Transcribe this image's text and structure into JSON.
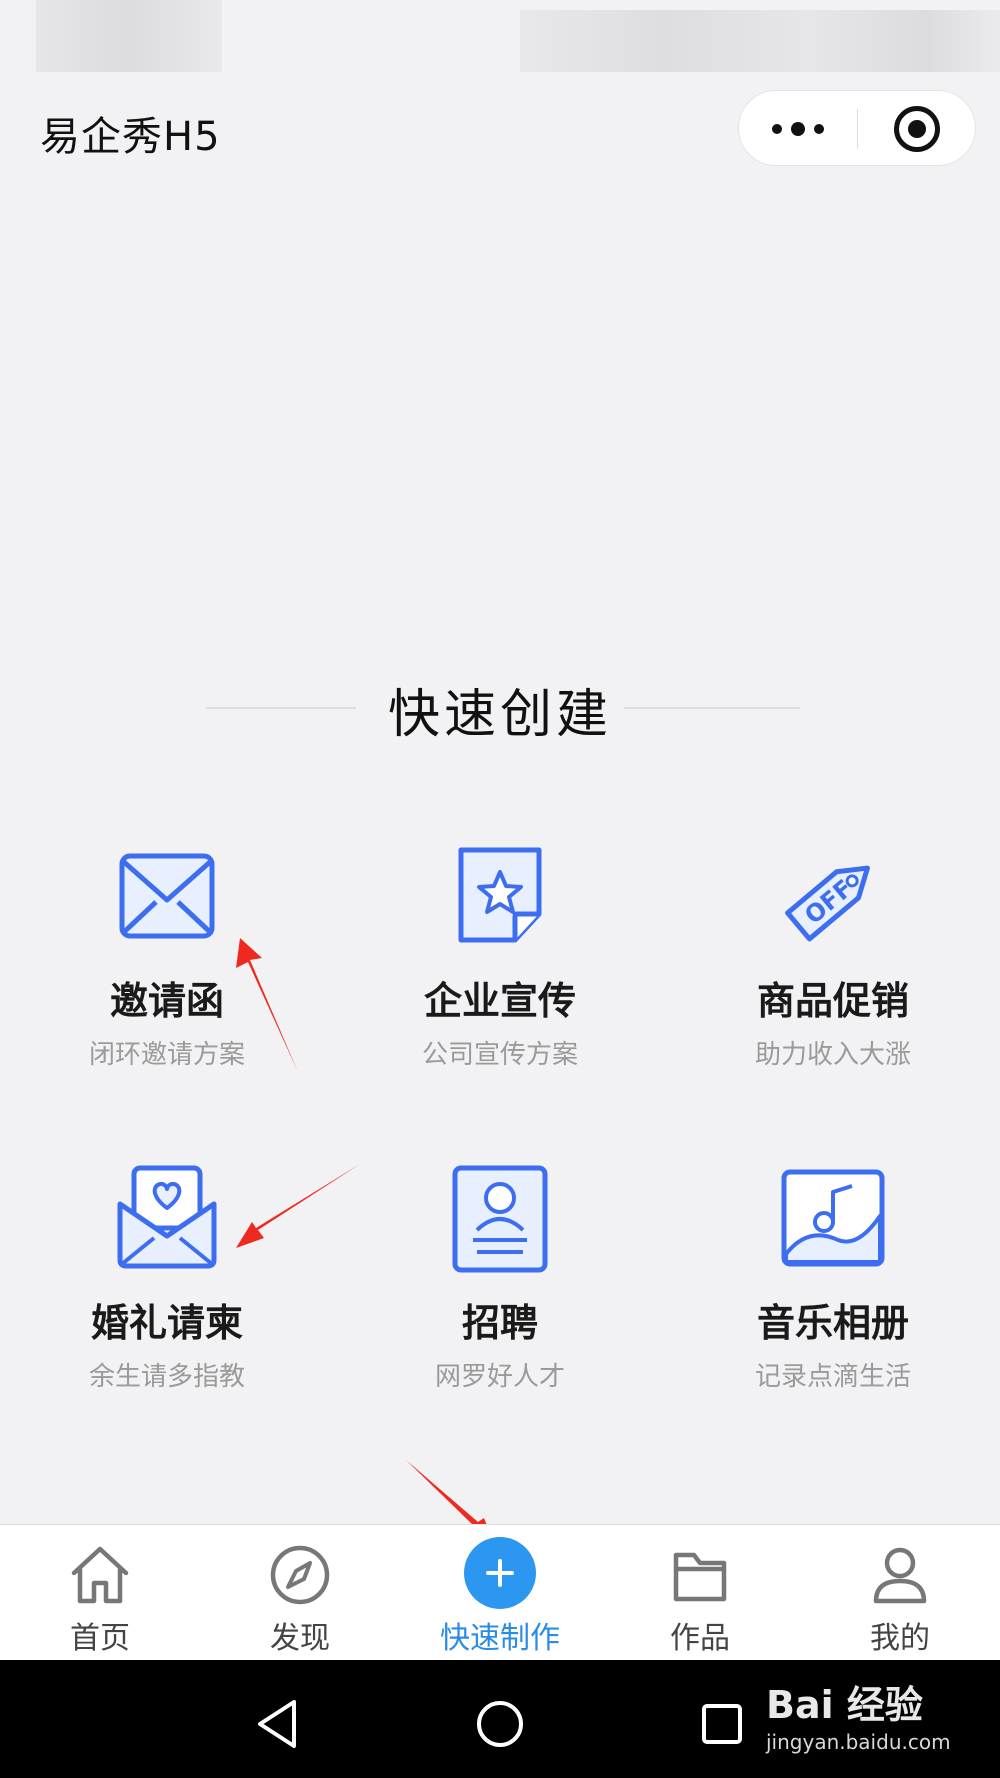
{
  "app": {
    "title": "易企秀H5"
  },
  "section": {
    "title": "快速创建"
  },
  "templates": [
    {
      "label": "邀请函",
      "desc": "闭环邀请方案",
      "icon": "envelope-icon"
    },
    {
      "label": "企业宣传",
      "desc": "公司宣传方案",
      "icon": "star-document-icon"
    },
    {
      "label": "商品促销",
      "desc": "助力收入大涨",
      "icon": "off-tag-icon"
    },
    {
      "label": "婚礼请柬",
      "desc": "余生请多指教",
      "icon": "heart-envelope-icon"
    },
    {
      "label": "招聘",
      "desc": "网罗好人才",
      "icon": "resume-icon"
    },
    {
      "label": "音乐相册",
      "desc": "记录点滴生活",
      "icon": "music-photo-icon"
    }
  ],
  "tabbar": [
    {
      "label": "首页",
      "icon": "home-icon"
    },
    {
      "label": "发现",
      "icon": "compass-icon"
    },
    {
      "label": "快速制作",
      "icon": "plus-icon",
      "active": true
    },
    {
      "label": "作品",
      "icon": "folder-icon"
    },
    {
      "label": "我的",
      "icon": "user-icon"
    }
  ],
  "watermark": {
    "brand": "Bai 经验",
    "url": "jingyan.baidu.com"
  },
  "colors": {
    "accent": "#2b97f0",
    "icon_stroke": "#3d6ef0",
    "icon_fill": "#e8efff",
    "arrow": "#ee2a1f"
  }
}
